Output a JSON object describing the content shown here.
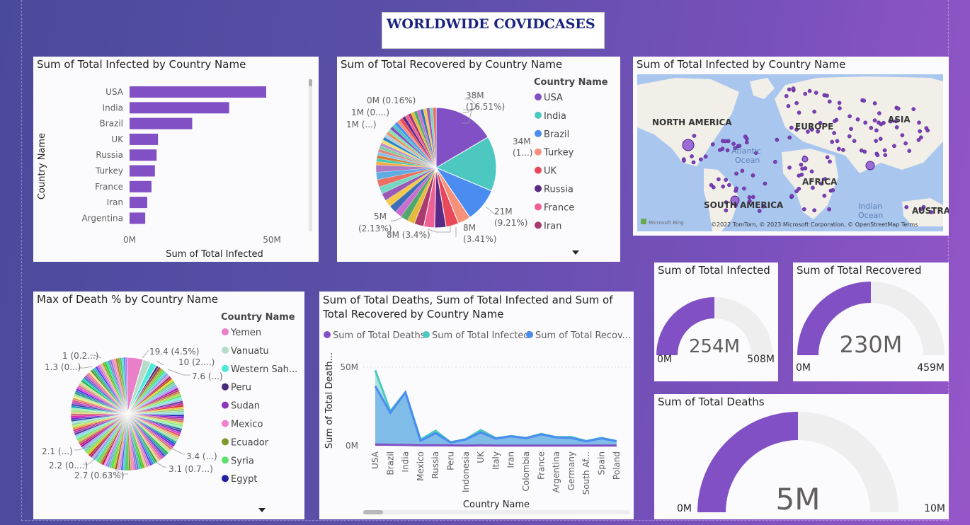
{
  "report": {
    "title": "WORLDWIDE COVIDCASES"
  },
  "bar_card": {
    "title": "Sum of Total Infected by Country Name",
    "y_axis_label": "Country Name",
    "x_axis_label": "Sum of Total Infected"
  },
  "recovered_pie": {
    "title": "Sum of Total Recovered by Country Name",
    "legend_title": "Country Name",
    "labels": [
      "38M\n(16.51%)",
      "34M\n(1...)",
      "21M\n(9.21%)",
      "8M\n(3.41%)",
      "8M (3.4%)",
      "5M\n(2.13%)",
      "1M (...)",
      "1M (0....)",
      "0M (0.16%)"
    ]
  },
  "map": {
    "title": "Sum of Total Infected by Country Name",
    "labels": [
      "NORTH AMERICA",
      "EUROPE",
      "ASIA",
      "AFRICA",
      "SOUTH AMERICA",
      "AUSTRA"
    ],
    "oceans": [
      "Atlantic\nOcean",
      "Indian\nOcean"
    ],
    "attribution": "©2022 TomTom, © 2023 Microsoft Corporation, © OpenStreetMap  Terms",
    "brand": "Microsoft Bing"
  },
  "death_pie": {
    "title": "Max of Death % by Country Name",
    "legend_title": "Country Name",
    "labels": [
      "19.4 (4.5%)",
      "10 (2....)",
      "7.6 (...)",
      "1 (0.2...)",
      "1.3 (0...)",
      "3.4 (...)",
      "3.1 (0.7...)",
      "2.1 (...)",
      "2.2 (0....)",
      "2.7 (0.63%)"
    ]
  },
  "area_card": {
    "title_line1": "Sum of Total Deaths, Sum of Total Infected and Sum of",
    "title_line2": "Total Recovered by Country Name",
    "y_axis_label": "Sum of Total Death...",
    "x_axis_label": "Country Name"
  },
  "gauges": [
    {
      "title": "Sum of Total Infected",
      "value": "254M",
      "min": "0M",
      "max": "508M",
      "fraction": 0.5
    },
    {
      "title": "Sum of Total Recovered",
      "value": "230M",
      "min": "0M",
      "max": "459M",
      "fraction": 0.5
    },
    {
      "title": "Sum of Total Deaths",
      "value": "5M",
      "min": "0M",
      "max": "10M",
      "fraction": 0.5
    }
  ],
  "colors": {
    "purple": "#8150c4",
    "teal": "#4cc8c0",
    "blue": "#4a8cf0",
    "track": "#efeeee"
  },
  "chart_data": [
    {
      "type": "bar",
      "title": "Sum of Total Infected by Country Name",
      "orientation": "horizontal",
      "categories": [
        "USA",
        "India",
        "Brazil",
        "UK",
        "Russia",
        "Turkey",
        "France",
        "Iran",
        "Argentina"
      ],
      "values": [
        48,
        35,
        22,
        10,
        9.5,
        8.9,
        7.7,
        6.2,
        5.5
      ],
      "xlabel": "Sum of Total Infected",
      "ylabel": "Country Name",
      "x_ticks": [
        "0M",
        "50M"
      ],
      "xlim": [
        0,
        50
      ]
    },
    {
      "type": "pie",
      "title": "Sum of Total Recovered by Country Name",
      "legend": [
        "USA",
        "India",
        "Brazil",
        "Turkey",
        "UK",
        "Russia",
        "France",
        "Iran"
      ],
      "legend_colors": [
        "#8150c4",
        "#4cc8c0",
        "#4a8cf0",
        "#f99079",
        "#e8485a",
        "#5b2a86",
        "#ef5f96",
        "#a83a6e"
      ],
      "values": [
        16.51,
        14.8,
        9.21,
        3.41,
        3.4,
        3.1,
        2.9,
        2.6
      ]
    },
    {
      "type": "pie",
      "title": "Max of Death % by Country Name",
      "legend": [
        "Yemen",
        "Vanuatu",
        "Western Sah...",
        "Peru",
        "Sudan",
        "Mexico",
        "Ecuador",
        "Syria",
        "Egypt"
      ],
      "legend_colors": [
        "#e97fc7",
        "#b5dcc8",
        "#4ee8d8",
        "#4a2a7a",
        "#8e34b8",
        "#f07fcf",
        "#7a9a2a",
        "#5ce06a",
        "#2020a0"
      ],
      "values": [
        4.5,
        2.3,
        1.8,
        0.8
      ]
    },
    {
      "type": "area",
      "title": "Sum of Total Deaths, Sum of Total Infected and Sum of Total Recovered by Country Name",
      "categories": [
        "USA",
        "Brazil",
        "India",
        "Mexico",
        "Russia",
        "Peru",
        "Indonesia",
        "UK",
        "Italy",
        "Iran",
        "Colombia",
        "France",
        "Argentina",
        "Germany",
        "South Af...",
        "Spain",
        "Poland"
      ],
      "y_ticks": [
        "0M",
        "50M"
      ],
      "ylim": [
        0,
        55
      ],
      "series": [
        {
          "name": "Sum of Total Deaths",
          "values": [
            0.8,
            0.6,
            0.5,
            0.3,
            0.3,
            0.2,
            0.1,
            0.2,
            0.1,
            0.1,
            0.1,
            0.1,
            0.1,
            0.1,
            0.1,
            0.1,
            0.1
          ]
        },
        {
          "name": "Sum of Total Infected",
          "values": [
            48,
            22,
            34,
            4,
            9.5,
            2.2,
            4.2,
            10,
            4.8,
            6.2,
            5,
            7.5,
            5.5,
            5.5,
            3,
            5,
            3
          ]
        },
        {
          "name": "Sum of Total Recov...",
          "values": [
            38,
            21,
            34,
            3.2,
            8,
            2.1,
            4,
            8.5,
            4.5,
            6,
            4.8,
            7.3,
            5.3,
            5,
            2.8,
            4.7,
            2.9
          ]
        }
      ]
    }
  ]
}
